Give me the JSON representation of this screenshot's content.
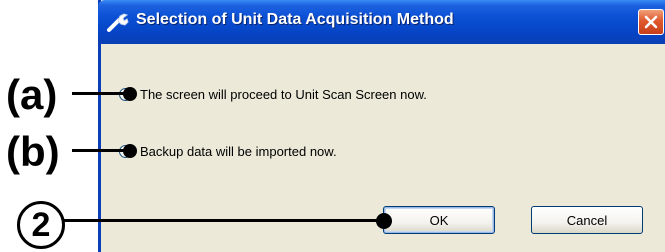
{
  "dialog": {
    "title": "Selection of Unit Data Acquisition Method",
    "title_icon": "wrench-icon",
    "close_icon": "close-icon",
    "options": [
      {
        "label": "The screen will proceed to Unit Scan Screen now.",
        "selected": true
      },
      {
        "label": "Backup data will be imported now.",
        "selected": false
      }
    ],
    "ok_label": "OK",
    "cancel_label": "Cancel"
  },
  "callouts": {
    "a": "(a)",
    "b": "(b)",
    "c": "2"
  },
  "colors": {
    "titlebar": "#0a4fd4",
    "dialog_face": "#ece9d8",
    "close_button": "#e0582d",
    "radio_selected": "#2aa12a"
  }
}
